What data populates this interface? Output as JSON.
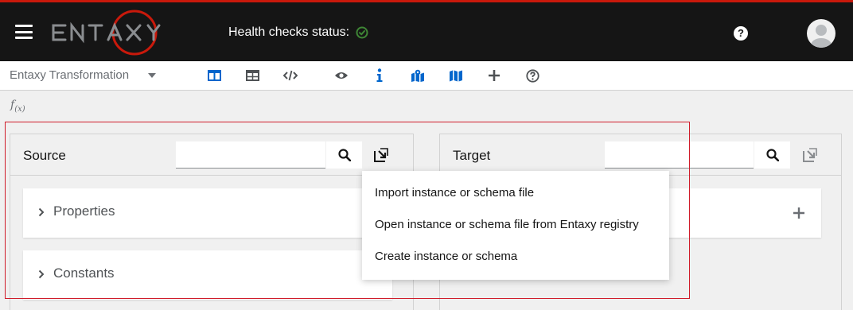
{
  "header": {
    "logo_text": "ENTAXY",
    "health_label": "Health checks status:",
    "health_status": "ok",
    "colors": {
      "background": "#151515",
      "accent": "#c9190b",
      "health_ok": "#3e8635"
    }
  },
  "toolbar": {
    "document_select": "Entaxy Transformation",
    "icons": [
      "columns-icon",
      "table-icon",
      "code-icon",
      "eye-icon",
      "info-icon",
      "map-marked-icon",
      "map-icon",
      "plus-icon",
      "question-circle-icon"
    ],
    "accent": "#0066cc"
  },
  "formula_bar": {
    "label": "f",
    "sub": "(x)"
  },
  "source_panel": {
    "title": "Source",
    "search_value": "",
    "items": [
      {
        "label": "Properties"
      },
      {
        "label": "Constants"
      }
    ]
  },
  "target_panel": {
    "title": "Target",
    "search_value": ""
  },
  "import_menu": {
    "items": [
      {
        "label": "Import instance or schema file"
      },
      {
        "label": "Open instance or schema file from Entaxy registry"
      },
      {
        "label": "Create instance or schema"
      }
    ]
  }
}
